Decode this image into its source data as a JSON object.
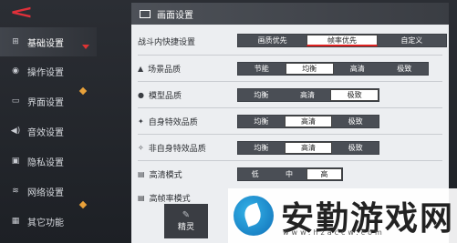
{
  "sidebar": {
    "items": [
      {
        "label": "基础设置",
        "icon": "sliders-icon",
        "glyph": "⚙",
        "active": true
      },
      {
        "label": "操作设置",
        "icon": "gamepad-icon",
        "glyph": "🎮",
        "active": false
      },
      {
        "label": "界面设置",
        "icon": "screen-icon",
        "glyph": "▭",
        "active": false
      },
      {
        "label": "音效设置",
        "icon": "speaker-icon",
        "glyph": "🔊",
        "active": false
      },
      {
        "label": "隐私设置",
        "icon": "lock-icon",
        "glyph": "🔒",
        "active": false
      },
      {
        "label": "网络设置",
        "icon": "wifi-icon",
        "glyph": "📶",
        "active": false
      },
      {
        "label": "其它功能",
        "icon": "grid-icon",
        "glyph": "▦",
        "active": false
      }
    ]
  },
  "panel": {
    "title": "画面设置",
    "shortcut": {
      "label": "战斗内快捷设置",
      "options": [
        "画质优先",
        "帧率优先",
        "自定义"
      ],
      "selected": 1
    },
    "scene": {
      "label": "场景品质",
      "options": [
        "节能",
        "均衡",
        "高清",
        "极致"
      ],
      "selected": 1
    },
    "model": {
      "label": "模型品质",
      "options": [
        "均衡",
        "高清",
        "极致"
      ],
      "selected": 2
    },
    "self_fx": {
      "label": "自身特效品质",
      "options": [
        "均衡",
        "高清",
        "极致"
      ],
      "selected": 1
    },
    "other_fx": {
      "label": "非自身特效品质",
      "options": [
        "均衡",
        "高清",
        "极致"
      ],
      "selected": 1
    },
    "hd_mode": {
      "label": "高清模式",
      "options": [
        "低",
        "中",
        "高"
      ],
      "selected": 2
    },
    "fps_mode": {
      "label": "高帧率模式"
    }
  },
  "spirit": {
    "label": "精灵"
  },
  "watermark": {
    "text": "安勤游戏网",
    "url": "www.hzaccw.com"
  },
  "colors": {
    "accent": "#d9333d",
    "panel": "#eceef1",
    "segment": "#4a4e55"
  }
}
